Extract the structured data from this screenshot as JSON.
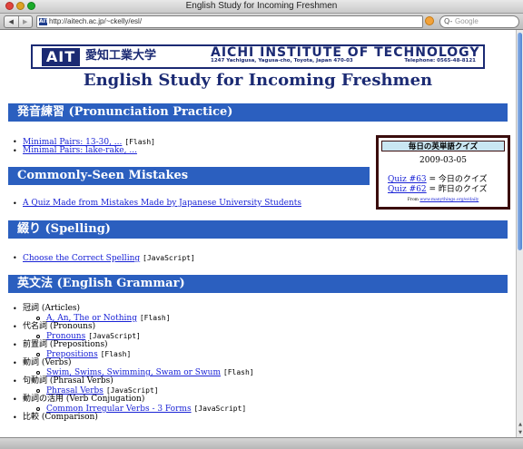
{
  "window": {
    "title": "English Study for Incoming Freshmen"
  },
  "toolbar": {
    "back_glyph": "◀",
    "forward_glyph": "▶",
    "favicon_text": "AIT",
    "url": "http://aitech.ac.jp/~ckelly/esl/",
    "search_placeholder": "Google",
    "search_glyph": "Q-"
  },
  "banner": {
    "logo_text": "AIT",
    "name_jp": "愛知工業大学",
    "name_en": "AICHI INSTITUTE OF TECHNOLOGY",
    "address": "1247 Yachigusa, Yagusa-cho, Toyota, Japan 470-03",
    "telephone": "Telephone: 0565-48-8121"
  },
  "page_title": "English Study for Incoming Freshmen",
  "sections": {
    "pronunciation": {
      "heading": "発音練習 (Pronunciation Practice)",
      "items": [
        {
          "link": "Minimal Pairs: 13-30, ...",
          "tag": "[Flash]"
        },
        {
          "link": "Minimal Pairs: lake-rake, ...",
          "tag": ""
        }
      ]
    },
    "mistakes": {
      "heading": "Commonly-Seen Mistakes",
      "items": [
        {
          "link": "A Quiz Made from Mistakes Made by Japanese University Students",
          "tag": ""
        }
      ]
    },
    "spelling": {
      "heading": "綴り (Spelling)",
      "items": [
        {
          "link": "Choose the Correct Spelling",
          "tag": "[JavaScript]"
        }
      ]
    },
    "grammar": {
      "heading": "英文法 (English Grammar)",
      "items": [
        {
          "label": "冠詞 (Articles)",
          "sub_link": "A, An, The or Nothing",
          "sub_tag": "[Flash]"
        },
        {
          "label": "代名詞 (Pronouns)",
          "sub_link": "Pronouns",
          "sub_tag": "[JavaScript]"
        },
        {
          "label": "前置詞 (Prepositions)",
          "sub_link": "Prepositions",
          "sub_tag": "[Flash]"
        },
        {
          "label": "動詞 (Verbs)",
          "sub_link": "Swim, Swims, Swimming, Swam or Swum",
          "sub_tag": "[Flash]"
        },
        {
          "label": "句動詞 (Phrasal Verbs)",
          "sub_link": "Phrasal Verbs",
          "sub_tag": "[JavaScript]"
        },
        {
          "label": "動詞の活用 (Verb Conjugation)",
          "sub_link": "Common Irregular Verbs - 3 Forms",
          "sub_tag": "[JavaScript]"
        },
        {
          "label": "比較 (Comparison)"
        }
      ]
    }
  },
  "quiz": {
    "heading": "毎日の英単語クイズ",
    "date": "2009-03-05",
    "today_link": "Quiz #63",
    "today_text": " = 今日のクイズ",
    "yesterday_link": "Quiz #62",
    "yesterday_text": " = 昨日のクイズ",
    "from_label": "From ",
    "from_link": "www.manythings.org/e/daily"
  },
  "colors": {
    "section_bar": "#2b5fbf",
    "navy": "#1b2a73",
    "link": "#1a23d6",
    "quiz_border": "#3a0d0d",
    "quiz_header": "#c9e6f2"
  }
}
